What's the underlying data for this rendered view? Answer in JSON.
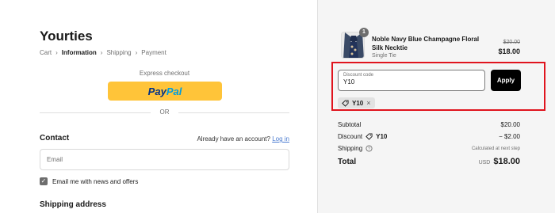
{
  "store": {
    "name": "Yourties"
  },
  "breadcrumb": {
    "cart": "Cart",
    "information": "Information",
    "shipping": "Shipping",
    "payment": "Payment"
  },
  "express": {
    "label": "Express checkout",
    "paypal_part1": "Pay",
    "paypal_part2": "Pal"
  },
  "divider": {
    "or": "OR"
  },
  "contact": {
    "title": "Contact",
    "account_question": "Already have an account?",
    "login_link": "Log in",
    "email_placeholder": "Email",
    "newsletter_label": "Email me with news and offers",
    "newsletter_checked": true
  },
  "shipping_address": {
    "title": "Shipping address"
  },
  "order": {
    "item": {
      "name": "Noble Navy Blue Champagne Floral Silk Necktie",
      "variant": "Single Tie",
      "quantity": "1",
      "price_original": "$20.00",
      "price_current": "$18.00"
    },
    "discount": {
      "label": "Discount code",
      "value": "Y10",
      "apply_label": "Apply",
      "applied_code": "Y10"
    },
    "summary": {
      "subtotal_label": "Subtotal",
      "subtotal_value": "$20.00",
      "discount_label": "Discount",
      "discount_code": "Y10",
      "discount_value": "− $2.00",
      "shipping_label": "Shipping",
      "shipping_value": "Calculated at next step",
      "total_label": "Total",
      "total_currency": "USD",
      "total_value": "$18.00"
    }
  },
  "colors": {
    "paypal_yellow": "#ffc439",
    "paypal_blue_dark": "#003087",
    "paypal_blue_light": "#009cde",
    "highlight_red": "#e0141e",
    "summary_bg": "#f5f5f5"
  }
}
